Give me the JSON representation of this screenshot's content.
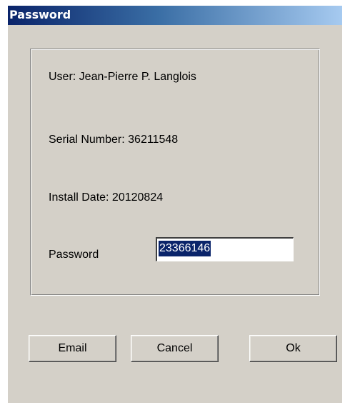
{
  "window": {
    "title": "Password"
  },
  "info": {
    "user": "User: Jean-Pierre P. Langlois",
    "serial_number": "Serial Number: 36211548",
    "install_date": "Install Date: 20120824"
  },
  "password": {
    "label": "Password",
    "value": "23366146"
  },
  "buttons": {
    "email": "Email",
    "cancel": "Cancel",
    "ok": "Ok"
  },
  "colors": {
    "dialog_face": "#d4d0c8",
    "titlebar_start": "#0a246a",
    "titlebar_end": "#a6caf0",
    "selection": "#0a246a"
  }
}
